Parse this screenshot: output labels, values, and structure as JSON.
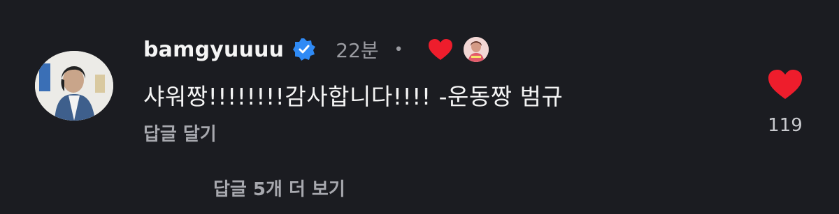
{
  "comment": {
    "username": "bamgyuuuu",
    "timestamp": "22분",
    "separator": "•",
    "text": "샤워짱!!!!!!!!감사합니다!!!! -운동짱 범규",
    "reply_label": "답글 달기",
    "like_count": "119",
    "view_replies_label": "답글 5개 더 보기"
  },
  "icons": {
    "verified": "verified-badge-icon",
    "creator_liked": "heart-icon",
    "creator_avatar": "creator-avatar",
    "like": "heart-icon"
  },
  "colors": {
    "background": "#1b1c21",
    "heart": "#ee1d2c",
    "verified": "#2f8af5",
    "muted_text": "#a7a8ae"
  }
}
